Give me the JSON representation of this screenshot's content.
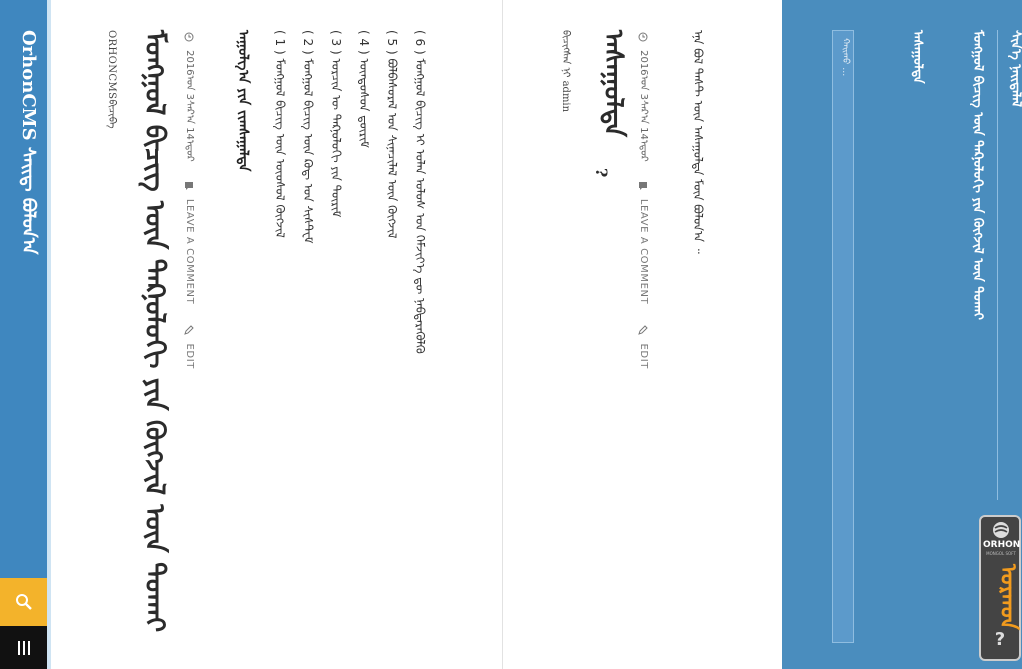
{
  "site": {
    "title": "OrhonCMS ᠰᠠᠢᠳ᠋ ᠪᠤᠯᠤᠨ᠎ᠠ",
    "search_icon": "search-icon",
    "menu_icon": "menu-icon"
  },
  "post1": {
    "title": "ᠠᠰᠠᠭᠤᠯᠲᠠ",
    "question_mark": "?",
    "author": "ᠪᠢᠴᠢᠭᠰᠡᠨ ᠨᠢ admin",
    "date": "2016ᠣᠨ 3ᠰᠠᠷ᠎ᠠ 14ᠡᠳᠦᠷ",
    "comment_label": "LEAVE A COMMENT",
    "edit_label": "EDIT",
    "body": "ᠡᠨᠡ ᠪᠣᠯ ᠲᠡᠰᠲ ᠦᠨ ᠠᠰᠠᠭᠤᠯᠲᠠ ᠮᠥᠨ ᠪᠣᠯᠤᠨ᠎ᠠ ᠃"
  },
  "post2": {
    "title": "ᠮᠣᠩᠭᠣᠯ ᠪᠢᠴᠢᠭ ᠦᠨ ᠲᠡᠺᠨᠣᠯᠣᠭᠢ ᠶᠢᠨ ᠬᠥᠭᠵᠢᠯ ᠦᠨ ᠲᠤᠬᠠᠢ",
    "author": "ORHONCMSᠪᠢᠴᠢᠪᠡ",
    "date": "2016ᠣᠨ 3ᠰᠠᠷ᠎ᠠ 14ᠡᠳᠦᠷ",
    "comment_label": "LEAVE A COMMENT",
    "edit_label": "EDIT",
    "heading": "ᠠᠭᠤᠯᠭ᠎ᠠ ᠶᠢᠨ ᠵᠢᠭᠰᠠᠭᠠᠯᠲᠠ",
    "items": [
      "( 1 ) ᠮᠣᠩᠭᠣᠯ ᠪᠢᠴᠢᠭ ᠦᠨ ᠦᠦᠰᠦᠯ ᠬᠥᠭᠵᠢᠯ",
      "( 2 ) ᠮᠣᠩᠭᠣᠯ ᠪᠢᠴᠢᠭ ᠦᠨ ᠺᠣᠳ᠋ ᠤᠨ ᠰᠢᠰᠲ᠋ᠧᠮ",
      "( 3 ) ᠣᠷᠴᠢᠨ ᠦ ᠲᠡᠺᠨᠣᠯᠣᠭᠢ ᠶᠢᠨ ᠳᠦᠷᠢᠮ",
      "( 4 ) ᠦᠨᠳᠦᠰᠦᠨ ᠳ᠋ᠦᠷᠢᠮ",
      "( 5 ) ᠪᠣᠯᠪᠠᠰᠤᠷᠠᠯ ᠤᠨ ᠰᠢᠨᠡᠴᠢᠯᠡᠯ ᠦᠨ ᠬᠥᠭᠵᠢᠯ",
      "( 6 ) ᠮᠣᠩᠭᠣᠯ ᠪᠢᠴᠢᠭ ᠢ ᠣᠯᠠᠨ ᠤᠯᠤᠰ ᠤᠨ ᠬᠡᠮᠵᠢᠶ᠎ᠡ ᠳᠦ ᠨᠡᠪᠲᠡᠷᠡᠭᠦᠯᠬᠦ"
    ]
  },
  "sidebar": {
    "search_placeholder": "ᠬᠠᠢᠬᠤ …",
    "links": [
      "ᠰᠢᠨ᠎ᠡ ᠨᠡᠢᠲᠡᠯᠡᠯ",
      "ᠮᠣᠩᠭᠣᠯ ᠪᠢᠴᠢᠭ ᠦᠨ ᠲᠡᠺᠨᠣᠯᠣᠭᠢ ᠶᠢᠨ ᠬᠥᠭᠵᠢᠯ ᠦᠨ ᠲᠤᠬᠠᠢ",
      "ᠠᠰᠠᠭᠤᠯᠲᠠ"
    ]
  },
  "badge": {
    "brand": "ORHON",
    "sub": "MONGOL SOFT",
    "word": "ᠣᠷᠬᠣᠨ",
    "help_icon": "help-icon"
  },
  "colors": {
    "header_blue": "#3f87bf",
    "panel_blue": "#4a8dbe",
    "search_yellow": "#f3b32b",
    "badge_orange": "#f29b1d"
  }
}
